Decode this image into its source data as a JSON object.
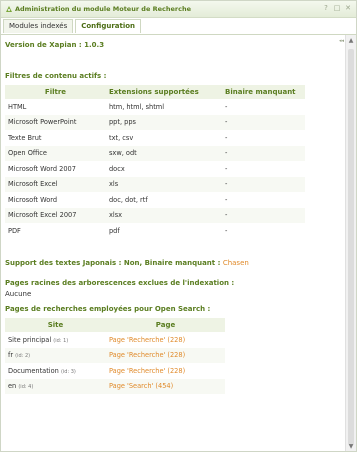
{
  "window": {
    "title": "Administration du module Moteur de Recherche",
    "controls": [
      "?",
      "□",
      "✕"
    ]
  },
  "tabs": [
    {
      "label": "Modules indexés",
      "active": false
    },
    {
      "label": "Configuration",
      "active": true
    }
  ],
  "version": {
    "label": "Version de Xapian : 1.0.3"
  },
  "filters": {
    "heading": "Filtres de contenu actifs :",
    "columns": [
      "Filtre",
      "Extensions supportées",
      "Binaire manquant"
    ],
    "rows": [
      {
        "name": "HTML",
        "ext": "htm, html, shtml",
        "missing": "-"
      },
      {
        "name": "Microsoft PowerPoint",
        "ext": "ppt, pps",
        "missing": "-"
      },
      {
        "name": "Texte Brut",
        "ext": "txt, csv",
        "missing": "-"
      },
      {
        "name": "Open Office",
        "ext": "sxw, odt",
        "missing": "-"
      },
      {
        "name": "Microsoft Word 2007",
        "ext": "docx",
        "missing": "-"
      },
      {
        "name": "Microsoft Excel",
        "ext": "xls",
        "missing": "-"
      },
      {
        "name": "Microsoft Word",
        "ext": "doc, dot, rtf",
        "missing": "-"
      },
      {
        "name": "Microsoft Excel 2007",
        "ext": "xlsx",
        "missing": "-"
      },
      {
        "name": "PDF",
        "ext": "pdf",
        "missing": "-"
      }
    ]
  },
  "japanese": {
    "label": "Support des textes Japonais : Non, Binaire manquant :",
    "value": "Chasen"
  },
  "excluded": {
    "heading": "Pages racines des arborescences exclues de l'indexation :",
    "value": "Aucune"
  },
  "opensearch": {
    "heading": "Pages de recherches employées pour Open Search :",
    "columns": [
      "Site",
      "Page"
    ],
    "rows": [
      {
        "site": "Site principal",
        "site_id": "(id: 1)",
        "page": "Page 'Recherche' (228)"
      },
      {
        "site": "fr",
        "site_id": "(id: 2)",
        "page": "Page 'Recherche' (228)"
      },
      {
        "site": "Documentation",
        "site_id": "(id: 3)",
        "page": "Page 'Recherche' (228)"
      },
      {
        "site": "en",
        "site_id": "(id: 4)",
        "page": "Page 'Search' (454)"
      }
    ]
  },
  "colors": {
    "accent_green": "#5a7d20",
    "link_orange": "#e08a2a"
  },
  "icons": {
    "logo": "module-logo-icon",
    "help": "help-icon",
    "maximize": "maximize-icon",
    "close": "close-icon"
  }
}
